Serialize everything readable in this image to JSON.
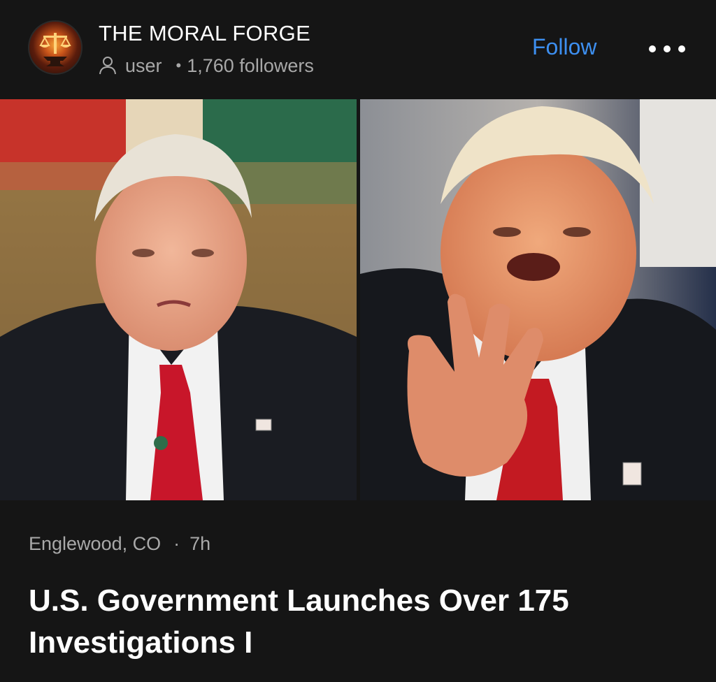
{
  "header": {
    "publisher_name": "THE MORAL FORGE",
    "role": "user",
    "separator": "•",
    "followers": "1,760 followers",
    "follow_label": "Follow",
    "avatar_icon": "scales-of-justice-anvil-logo",
    "user_icon": "person-outline-icon",
    "more_icon": "more-horizontal-icon"
  },
  "images": [
    {
      "description_icon": "photo-left"
    },
    {
      "description_icon": "photo-right"
    }
  ],
  "post": {
    "location": "Englewood, CO",
    "separator": "·",
    "time": "7h",
    "headline": "U.S. Government Launches Over 175 Investigations I"
  },
  "colors": {
    "background": "#151515",
    "accent_link": "#3d8ff0",
    "secondary_text": "#a8a8a8",
    "primary_text": "#ffffff"
  }
}
